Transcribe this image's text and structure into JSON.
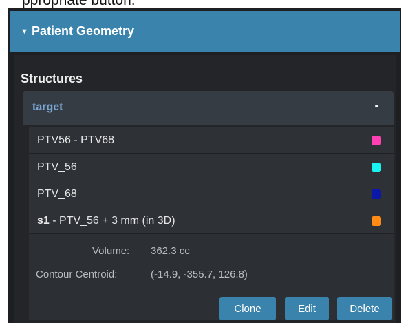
{
  "cut_off_text": "ppropriate button.",
  "panel": {
    "caret": "▼",
    "title": "Patient Geometry"
  },
  "structures": {
    "heading": "Structures",
    "group": {
      "label": "target",
      "collapse": "-"
    },
    "items": [
      {
        "name_bold": "",
        "label": "PTV56 - PTV68",
        "color": "#ff3fb4"
      },
      {
        "name_bold": "",
        "label": "PTV_56",
        "color": "#19f4f0"
      },
      {
        "name_bold": "",
        "label": "PTV_68",
        "color": "#0a17a8"
      },
      {
        "name_bold": "s1",
        "label": " - PTV_56 + 3 mm (in 3D)",
        "color": "#ff8a14"
      }
    ]
  },
  "details": {
    "volume_label": "Volume:",
    "volume_value": "362.3 cc",
    "centroid_label": "Contour Centroid:",
    "centroid_value": "(-14.9, -355.7, 126.8)"
  },
  "buttons": {
    "clone": "Clone",
    "edit": "Edit",
    "delete": "Delete"
  }
}
